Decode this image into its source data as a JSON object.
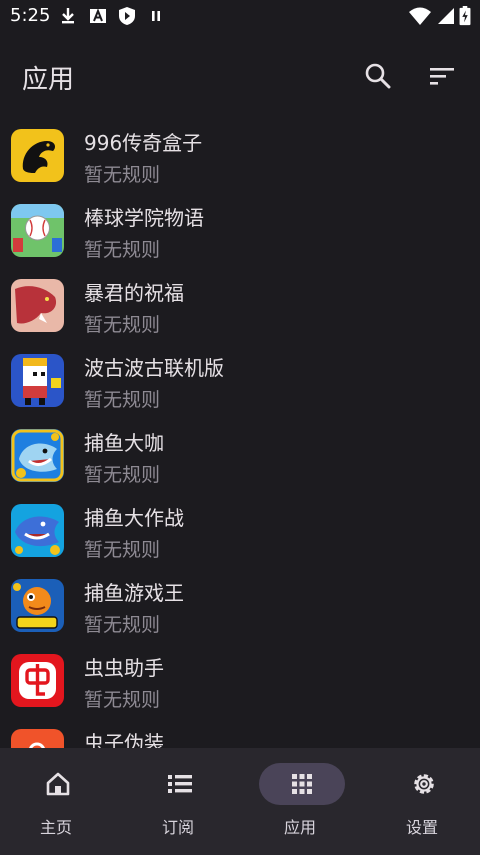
{
  "status_bar": {
    "time": "5:25",
    "left_icons": [
      "download-icon",
      "a-box-icon",
      "shield-icon",
      "pause-icon"
    ],
    "right_icons": [
      "wifi-icon",
      "signal-icon",
      "battery-charging-icon"
    ]
  },
  "app_bar": {
    "title": "应用",
    "actions": [
      "search-icon",
      "sort-icon"
    ]
  },
  "apps": [
    {
      "name": "996传奇盒子",
      "rule": "暂无规则",
      "icon": "yellow-dragon-icon"
    },
    {
      "name": "棒球学院物语",
      "rule": "暂无规则",
      "icon": "baseball-icon"
    },
    {
      "name": "暴君的祝福",
      "rule": "暂无规则",
      "icon": "red-dragon-icon"
    },
    {
      "name": "波古波古联机版",
      "rule": "暂无规则",
      "icon": "pixel-character-icon"
    },
    {
      "name": "捕鱼大咖",
      "rule": "暂无规则",
      "icon": "shark-gold-icon"
    },
    {
      "name": "捕鱼大作战",
      "rule": "暂无规则",
      "icon": "shark-blue-icon"
    },
    {
      "name": "捕鱼游戏王",
      "rule": "暂无规则",
      "icon": "goldfish-1000-icon"
    },
    {
      "name": "虫虫助手",
      "rule": "暂无规则",
      "icon": "chongchong-icon"
    },
    {
      "name": "虫子伪装",
      "rule": "",
      "icon": "orange-app-icon"
    }
  ],
  "bottom_nav": {
    "items": [
      {
        "label": "主页",
        "icon": "home-icon",
        "active": false
      },
      {
        "label": "订阅",
        "icon": "list-icon",
        "active": false
      },
      {
        "label": "应用",
        "icon": "apps-grid-icon",
        "active": true
      },
      {
        "label": "设置",
        "icon": "gear-icon",
        "active": false
      }
    ]
  }
}
